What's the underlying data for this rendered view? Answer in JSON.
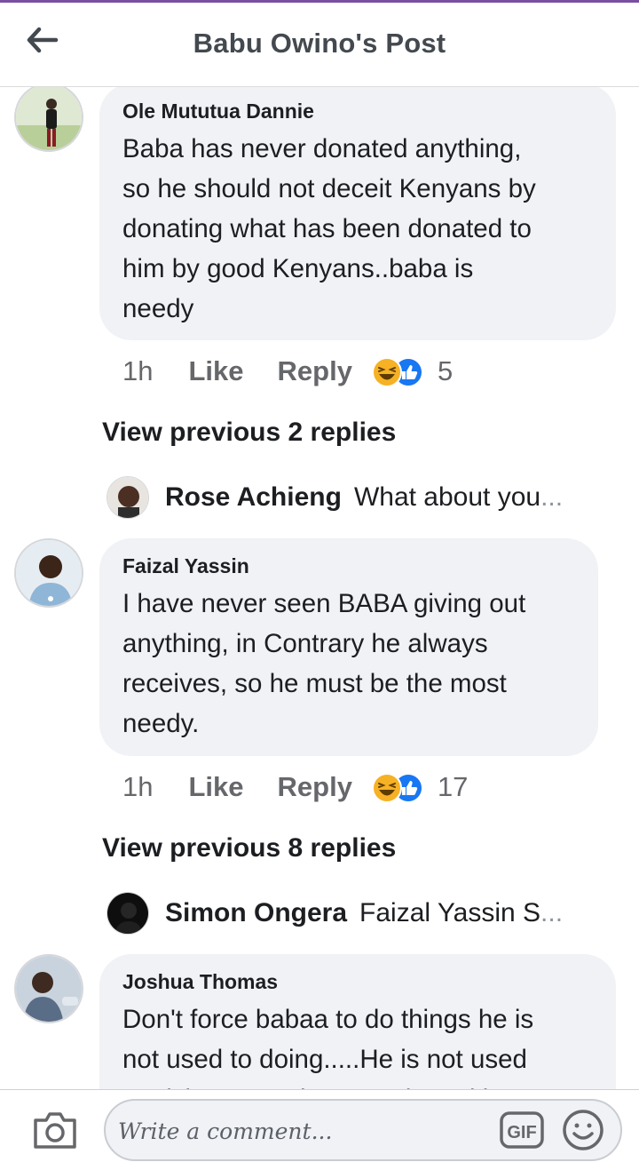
{
  "header": {
    "title": "Babu Owino's Post"
  },
  "comments": [
    {
      "author": "Ole Mututua Dannie",
      "lines": [
        "Baba has never donated anything,",
        "so he should not deceit Kenyans by",
        "donating what has been donated to",
        "him by good Kenyans..baba is",
        "needy"
      ],
      "time": "1h",
      "like": "Like",
      "reply": "Reply",
      "reactions": [
        "haha",
        "like"
      ],
      "reaction_count": "5",
      "view_previous": "View previous 2 replies",
      "latest_reply": {
        "name": "Rose Achieng",
        "text": "What about you",
        "ellipsis": "..."
      }
    },
    {
      "author": "Faizal Yassin",
      "lines": [
        "I have never seen BABA giving out",
        "anything, in Contrary he always",
        "receives, so he must be the most",
        "needy."
      ],
      "time": "1h",
      "like": "Like",
      "reply": "Reply",
      "reactions": [
        "haha",
        "like"
      ],
      "reaction_count": "17",
      "view_previous": "View previous 8 replies",
      "latest_reply": {
        "name": "Simon Ongera",
        "text": "Faizal Yassin S",
        "ellipsis": "..."
      }
    },
    {
      "author": "Joshua Thomas",
      "lines": [
        "Don't force babaa to do things he is",
        "not used to doing.....He is not used",
        "to giving out ... he's used to taking"
      ]
    }
  ],
  "composer": {
    "placeholder": "Write a comment...",
    "gif_label": "GIF",
    "icons": [
      "camera-icon",
      "gif-icon",
      "emoji-icon"
    ]
  },
  "colors": {
    "accent_top": "#7b4fa0",
    "bubble": "#f0f2f5",
    "meta": "#65676b",
    "like_blue": "#1877f2",
    "haha_yellow": "#f7b125"
  }
}
